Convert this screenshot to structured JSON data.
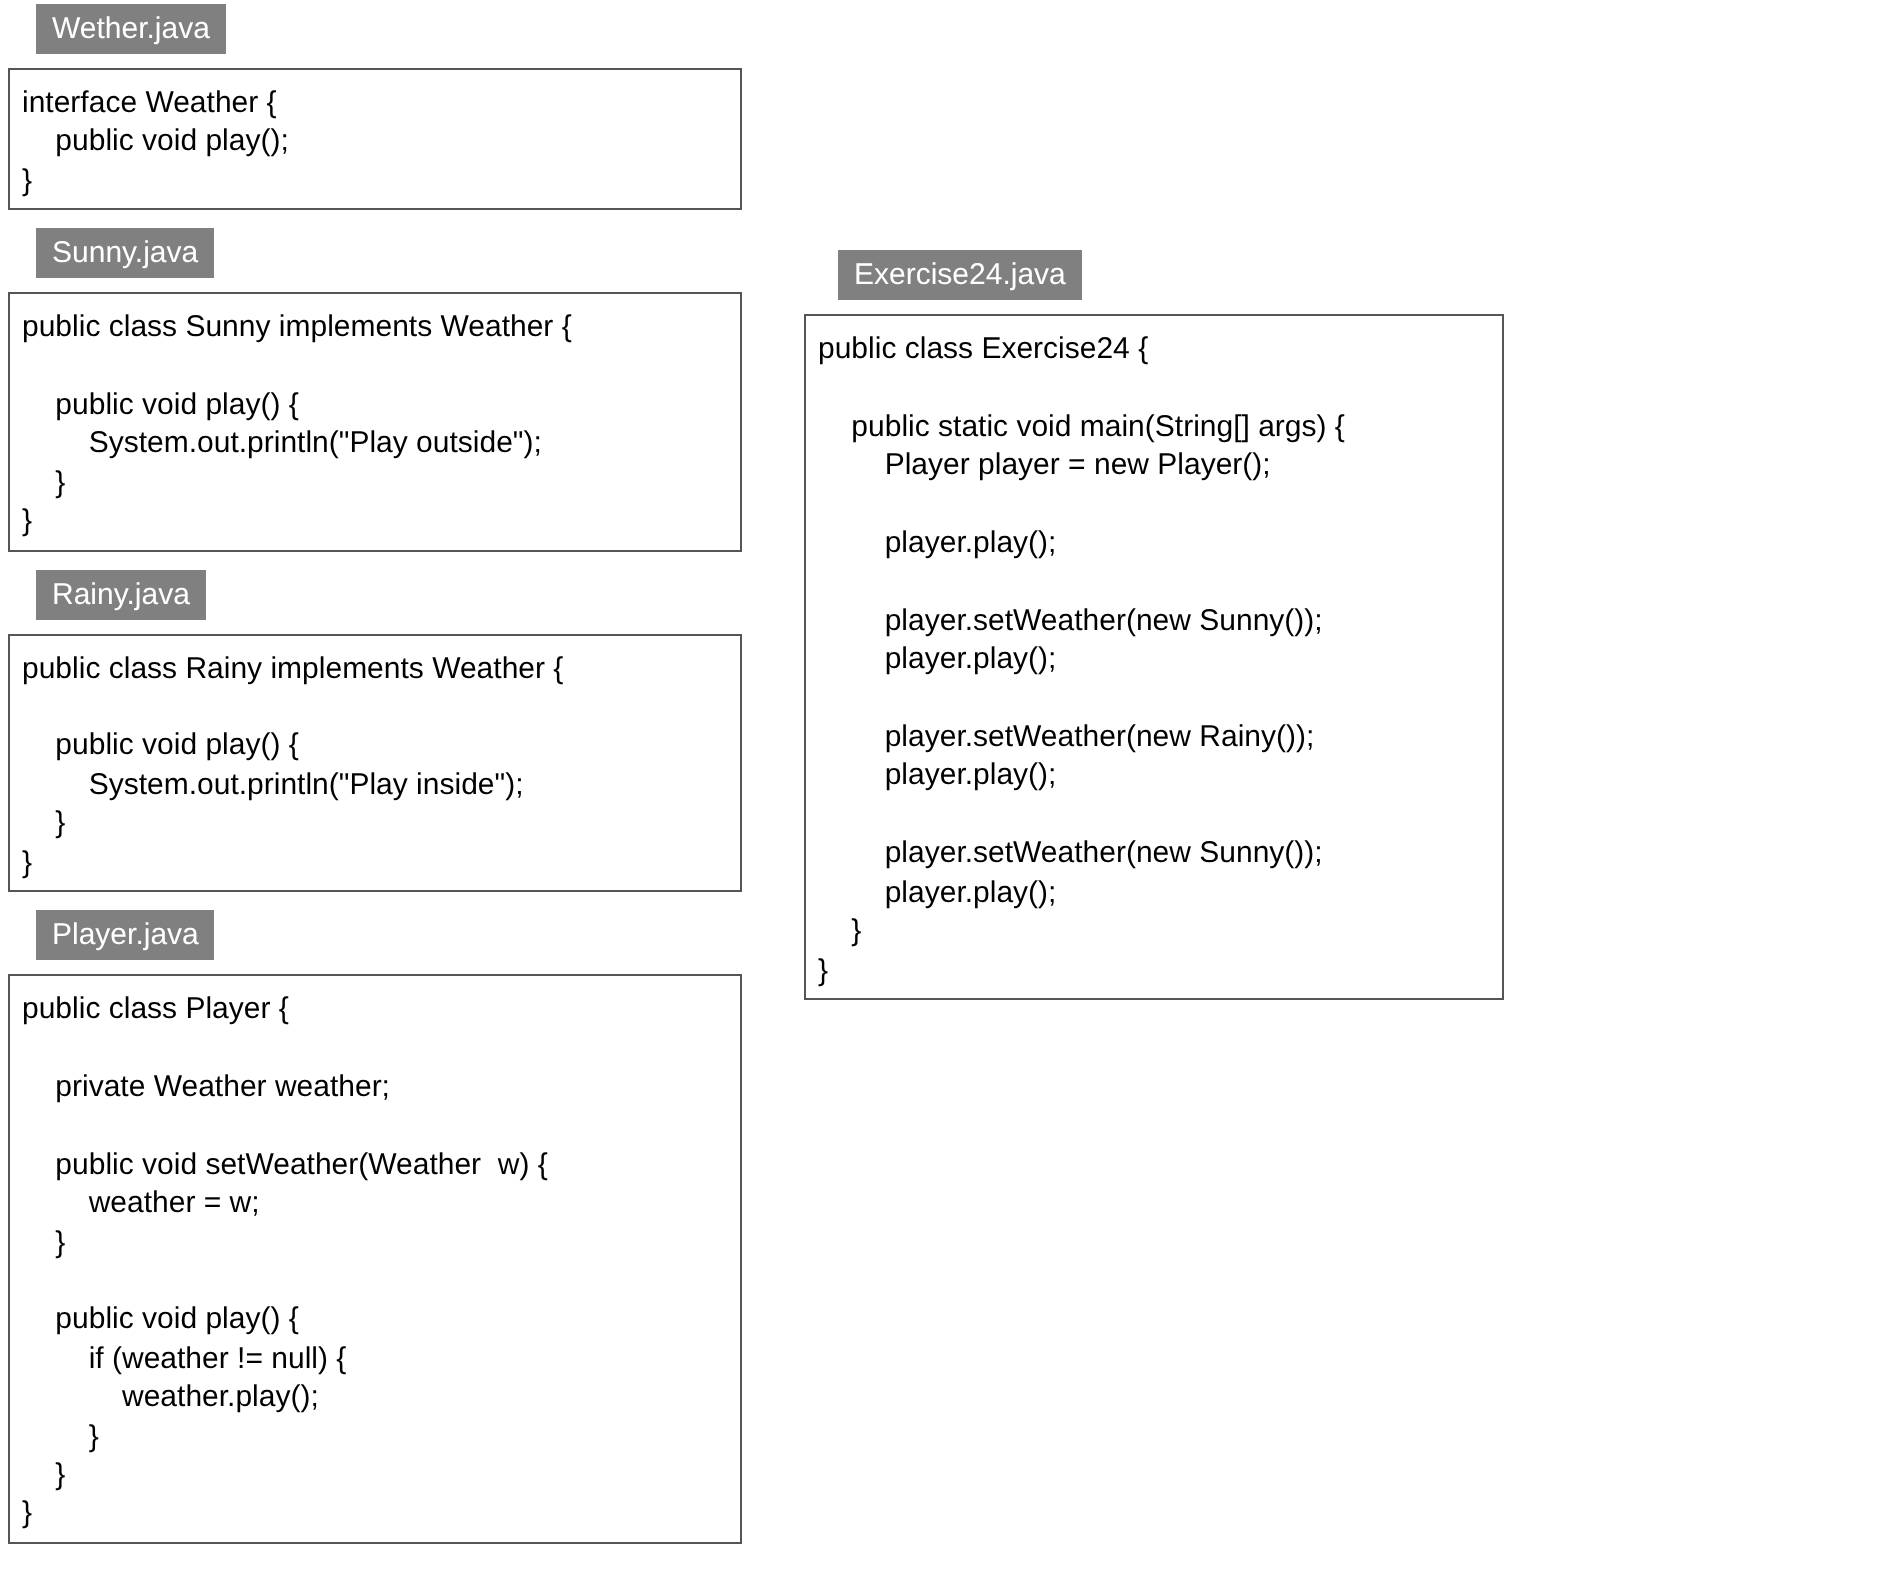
{
  "files": [
    {
      "filename": "Wether.java",
      "code": "interface Weather {\n    public void play();\n}"
    },
    {
      "filename": "Sunny.java",
      "code": "public class Sunny implements Weather {\n\n    public void play() {\n        System.out.println(\"Play outside\");\n    }\n}"
    },
    {
      "filename": "Rainy.java",
      "code": "public class Rainy implements Weather {\n\n    public void play() {\n        System.out.println(\"Play inside\");\n    }\n}"
    },
    {
      "filename": "Player.java",
      "code": "public class Player {\n\n    private Weather weather;\n\n    public void setWeather(Weather  w) {\n        weather = w;\n    }\n\n    public void play() {\n        if (weather != null) {\n            weather.play();\n        }\n    }\n}"
    },
    {
      "filename": "Exercise24.java",
      "code": "public class Exercise24 {\n\n    public static void main(String[] args) {\n        Player player = new Player();\n\n        player.play();\n\n        player.setWeather(new Sunny());\n        player.play();\n\n        player.setWeather(new Rainy());\n        player.play();\n\n        player.setWeather(new Sunny());\n        player.play();\n    }\n}"
    }
  ]
}
